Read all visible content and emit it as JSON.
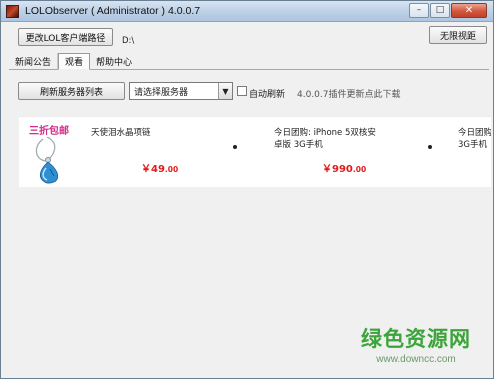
{
  "window": {
    "title": "LOLObserver ( Administrator ) 4.0.0.7",
    "controls": {
      "minimize": "–",
      "maximize": "□",
      "close": "✕"
    }
  },
  "toolbar": {
    "change_path_button": "更改LOL客户端路径",
    "path_value": "D:\\",
    "unlimited_view_button": "无限视距"
  },
  "tabs": [
    {
      "label": "新闻公告",
      "active": false
    },
    {
      "label": "观看",
      "active": true
    },
    {
      "label": "帮助中心",
      "active": false
    }
  ],
  "server_bar": {
    "refresh_button": "刷新服务器列表",
    "server_select_value": "请选择服务器",
    "auto_refresh_label": "自动刷新",
    "auto_refresh_checked": false,
    "update_notice": "4.0.0.7插件更新点此下载"
  },
  "ads": {
    "promo_label": "三折包邮",
    "products": [
      {
        "name": "天使泪水晶项链",
        "name_line2": "",
        "price_main": "￥49",
        "price_cents": ".00"
      },
      {
        "name": "今日团购: iPhone 5双核安",
        "name_line2": "卓版 3G手机",
        "price_main": "￥990",
        "price_cents": ".00"
      },
      {
        "name": "今日团购:",
        "name_line2": "3G手机",
        "price_main": "",
        "price_cents": ""
      }
    ]
  },
  "watermark": {
    "site_name": "绿色资源网",
    "site_url": "www.downcc.com"
  },
  "colors": {
    "promo": "#d22a8a",
    "price": "#e11b1b",
    "watermark": "#3ca43a"
  }
}
